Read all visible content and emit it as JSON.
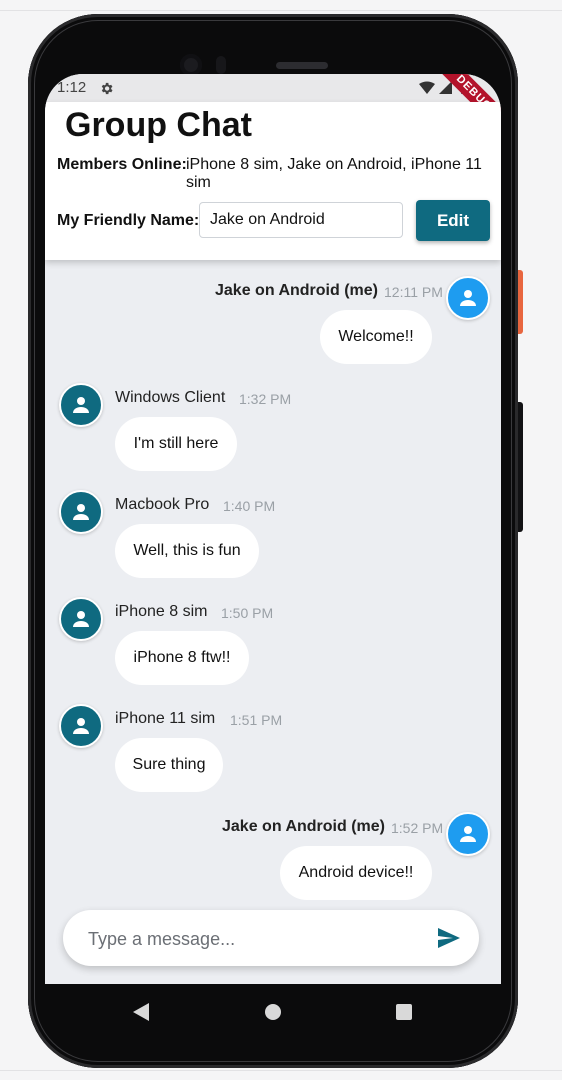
{
  "status_bar": {
    "time": "1:12",
    "debug_label": "DEBUG"
  },
  "header": {
    "title": "Group Chat",
    "members_label": "Members Online:",
    "members_value": "iPhone 8 sim, Jake on Android, iPhone 11 sim",
    "name_label": "My Friendly Name:",
    "name_value": "Jake on Android",
    "edit_label": "Edit"
  },
  "messages": [
    {
      "sender": "Jake on Android (me)",
      "time": "12:11 PM",
      "text": "Welcome!!",
      "is_me": true
    },
    {
      "sender": "Windows Client",
      "time": "1:32 PM",
      "text": "I'm still here",
      "is_me": false
    },
    {
      "sender": "Macbook Pro",
      "time": "1:40 PM",
      "text": "Well, this is fun",
      "is_me": false
    },
    {
      "sender": "iPhone 8 sim",
      "time": "1:50 PM",
      "text": "iPhone 8 ftw!!",
      "is_me": false
    },
    {
      "sender": "iPhone 11 sim",
      "time": "1:51 PM",
      "text": "Sure thing",
      "is_me": false
    },
    {
      "sender": "Jake on Android (me)",
      "time": "1:52 PM",
      "text": "Android device!!",
      "is_me": true
    }
  ],
  "composer": {
    "placeholder": "Type a message...",
    "value": ""
  },
  "colors": {
    "primary": "#0f6a80",
    "self_avatar": "#1e9cf0",
    "other_avatar": "#0f6a80",
    "chat_background": "#eceef2"
  },
  "icons": {
    "settings": "gear-icon",
    "avatar": "person-icon",
    "send": "send-icon",
    "nav": [
      "back-icon",
      "home-icon",
      "recents-icon"
    ]
  }
}
